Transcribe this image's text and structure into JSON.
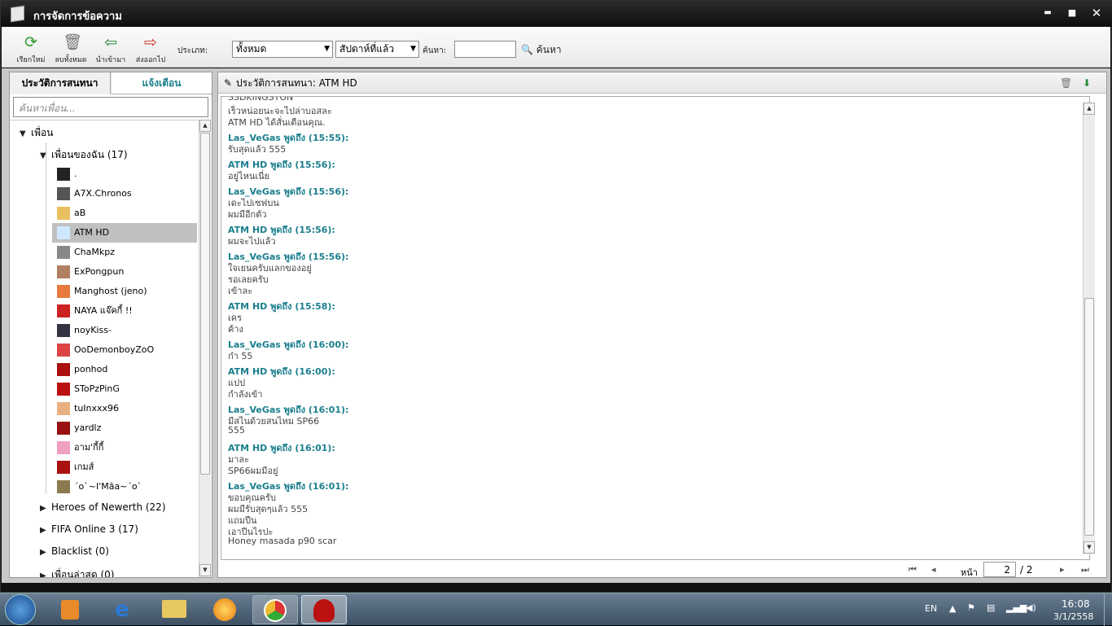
{
  "window": {
    "title": "การจัดการข้อความ",
    "min": "▬",
    "max": "■",
    "close": "✕"
  },
  "toolbar": {
    "refresh": "เรียกใหม่",
    "delete_all": "ลบทั้งหมด",
    "import": "นำเข้ามา",
    "export": "ส่งออกไป",
    "type_label": "ประเภท:",
    "type_value": "ทั้งหมด",
    "period_value": "สัปดาห์ที่แล้ว",
    "search_label": "ค้นหา:",
    "search_value": "",
    "search_btn": "ค้นหา"
  },
  "left": {
    "tab_history": "ประวัติการสนทนา",
    "tab_alert": "แจ้งเตือน",
    "search_placeholder": "ค้นหาเพื่อน...",
    "root": "เพื่อน",
    "my_friends": "เพื่อนของฉัน (17)",
    "friends": [
      ".",
      "A7X.Chronos",
      "aB",
      "ATM HD",
      "ChaMkpz",
      "ExPongpun",
      "Manghost (jeno)",
      "NAYA แจ๊คกี้ !!",
      "noyKiss-",
      "OoDemonboyZoO",
      "ponhod",
      "SToPzPinG",
      "tuInxxx96",
      "yardlz",
      "อาม'กี้กี้",
      "เกมส์",
      "ˊoˋ~I'Mãa~ˊoˋ"
    ],
    "groups": [
      "Heroes of Newerth (22)",
      "FIFA Online 3 (17)",
      "Blacklist (0)",
      "เพื่อนล่าสุด (0)"
    ]
  },
  "right": {
    "header": "ประวัติการสนทนา: ATM HD",
    "lines": [
      {
        "t": "SSDKINGSTON",
        "s": false
      },
      {
        "t": "เร็วหน่อยนะจะไปล่าบอสละ",
        "s": false
      },
      {
        "t": "ATM HD ได้สั่นเตือนคุณ.",
        "s": false
      },
      {
        "t": "Las_VeGas พูดถึง  (15:55):",
        "s": true
      },
      {
        "t": "รับสุดแล้ว 555",
        "s": false
      },
      {
        "t": "ATM HD พูดถึง  (15:56):",
        "s": true
      },
      {
        "t": "อยู่ไหนเนี่ย",
        "s": false
      },
      {
        "t": "Las_VeGas พูดถึง  (15:56):",
        "s": true
      },
      {
        "t": "เดะไปเซฟบน",
        "s": false
      },
      {
        "t": "ผมมีอีกตัว",
        "s": false
      },
      {
        "t": "ATM HD พูดถึง  (15:56):",
        "s": true
      },
      {
        "t": "ผมจะไปแล้ว",
        "s": false
      },
      {
        "t": "Las_VeGas พูดถึง  (15:56):",
        "s": true
      },
      {
        "t": "ใจเยนครับแลกของอยู่",
        "s": false
      },
      {
        "t": "รอเลยครับ",
        "s": false
      },
      {
        "t": "เข้าละ",
        "s": false
      },
      {
        "t": "ATM HD พูดถึง  (15:58):",
        "s": true
      },
      {
        "t": "เคร",
        "s": false
      },
      {
        "t": "ค้าง",
        "s": false
      },
      {
        "t": "Las_VeGas พูดถึง  (16:00):",
        "s": true
      },
      {
        "t": "ก๋า 55",
        "s": false
      },
      {
        "t": "ATM HD พูดถึง  (16:00):",
        "s": true
      },
      {
        "t": "แปป",
        "s": false
      },
      {
        "t": "กำลังเข้า",
        "s": false
      },
      {
        "t": "Las_VeGas พูดถึง  (16:01):",
        "s": true
      },
      {
        "t": "มีสไนด้วยสนไหม SP66",
        "s": false
      },
      {
        "t": "555",
        "s": false
      },
      {
        "t": "ATM HD พูดถึง  (16:01):",
        "s": true
      },
      {
        "t": "มาละ",
        "s": false
      },
      {
        "t": "SP66ผมมีอยู่",
        "s": false
      },
      {
        "t": "Las_VeGas พูดถึง  (16:01):",
        "s": true
      },
      {
        "t": "ขอบคุณครับ",
        "s": false
      },
      {
        "t": "ผมมีรับสุดๆแล้ว 555",
        "s": false
      },
      {
        "t": "แถมปืน",
        "s": false
      },
      {
        "t": "เอาปืนไรปะ",
        "s": false
      },
      {
        "t": "Honey masada p90 scar",
        "s": false
      }
    ],
    "page_label": "หน้า",
    "page_value": "2",
    "page_total": "/ 2"
  },
  "taskbar": {
    "lang": "EN",
    "time": "16:08",
    "date": "3/1/2558"
  }
}
